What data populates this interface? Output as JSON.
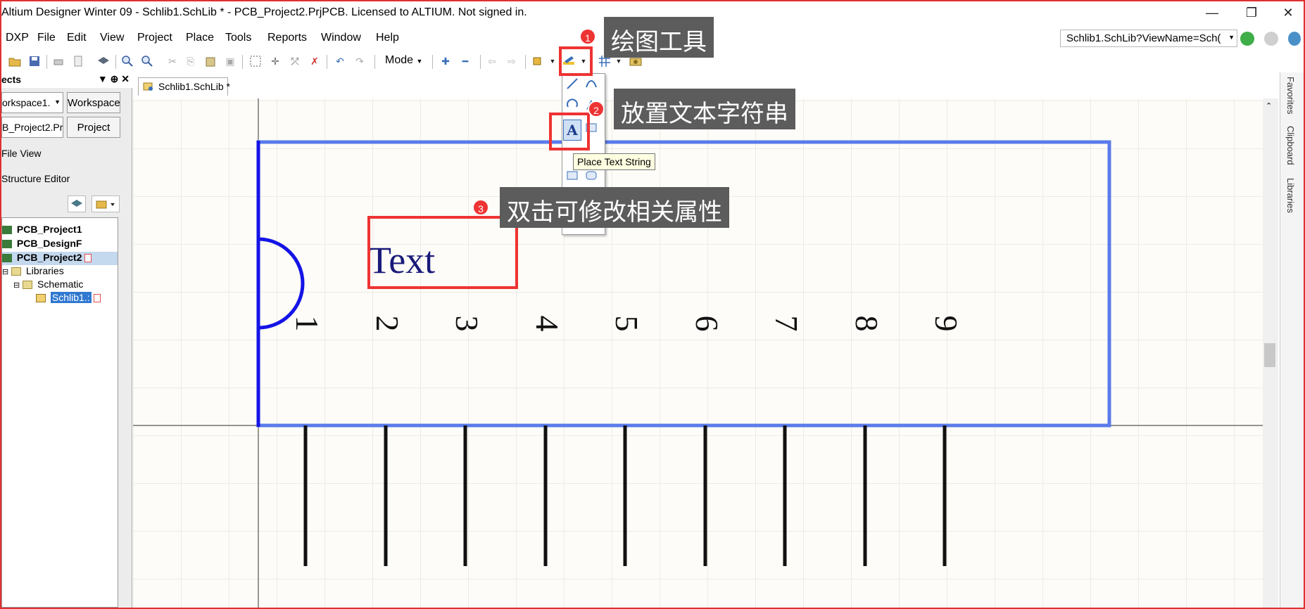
{
  "window": {
    "title": "Altium Designer Winter 09 - Schlib1.SchLib * - PCB_Project2.PrjPCB. Licensed to ALTIUM. Not signed in.",
    "controls": [
      "—",
      "❐",
      "✕"
    ]
  },
  "menu": [
    "DXP",
    "File",
    "Edit",
    "View",
    "Project",
    "Place",
    "Tools",
    "Reports",
    "Window",
    "Help"
  ],
  "navigation": {
    "view_name": "Schlib1.SchLib?ViewName=Sch("
  },
  "toolbar": {
    "mode_label": "Mode"
  },
  "projects_panel": {
    "header": "ects",
    "workspace_field": "orkspace1.",
    "workspace_button": "Workspace",
    "project_field": "B_Project2.Prj",
    "project_button": "Project",
    "file_view": "File View",
    "structure_editor": "Structure Editor",
    "tree": [
      {
        "label": "PCB_Project1",
        "bold": true
      },
      {
        "label": "PCB_DesignF",
        "bold": true
      },
      {
        "label": "PCB_Project2",
        "bold": true,
        "selected": true
      },
      {
        "label": "Libraries",
        "bold": false
      },
      {
        "label": "Schematic",
        "bold": false
      },
      {
        "label": "Schlib1.:",
        "bold": false,
        "selected": true
      }
    ]
  },
  "document_tab": "Schlib1.SchLib *",
  "right_panels": [
    "Favorites",
    "Clipboard",
    "Libraries"
  ],
  "schematic": {
    "placed_text": "Text",
    "pin_numbers": [
      "1",
      "2",
      "3",
      "4",
      "5",
      "6",
      "7",
      "8",
      "9"
    ]
  },
  "drawing_dropdown": {
    "place_text_glyph": "A",
    "tooltip": "Place Text String"
  },
  "annotations": [
    {
      "badge": "1",
      "label": "绘图工具"
    },
    {
      "badge": "2",
      "label": "放置文本字符串"
    },
    {
      "badge": "3",
      "label": "双击可修改相关属性"
    }
  ],
  "colors": {
    "component_outline": "#5a7bea",
    "pin_left_edge": "#1414e6",
    "placed_text": "#1a1a7a",
    "annotation_red": "#ee3333",
    "callout_bg": "#5c5c5c"
  }
}
